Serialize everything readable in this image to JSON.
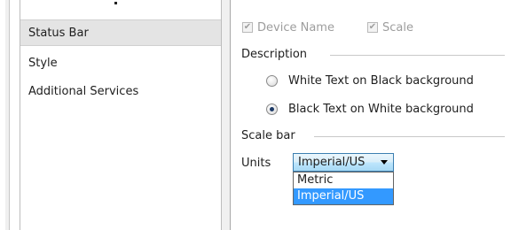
{
  "nav": {
    "items": [
      {
        "label": "Status Bar",
        "selected": true
      },
      {
        "label": "Style",
        "selected": false
      },
      {
        "label": "Additional Services",
        "selected": false
      }
    ]
  },
  "status_bar": {
    "device_name": {
      "label": "Device Name",
      "checked": true,
      "enabled": false
    },
    "scale": {
      "label": "Scale",
      "checked": true,
      "enabled": false
    }
  },
  "description": {
    "title": "Description",
    "options": [
      {
        "label": "White Text on Black background",
        "selected": false
      },
      {
        "label": "Black Text on White background",
        "selected": true
      }
    ]
  },
  "scale_bar": {
    "title": "Scale bar",
    "units_label": "Units",
    "selected_value": "Imperial/US",
    "options": [
      "Metric",
      "Imperial/US"
    ],
    "highlighted_option": "Imperial/US"
  },
  "colors": {
    "selection_highlight": "#3399ff",
    "selected_nav_bg": "#e4e4e4",
    "combo_border": "#3c7fb1"
  },
  "icons": {
    "checkbox": "check-mark",
    "radio": "radio-dot",
    "dropdown": "triangle-down"
  }
}
